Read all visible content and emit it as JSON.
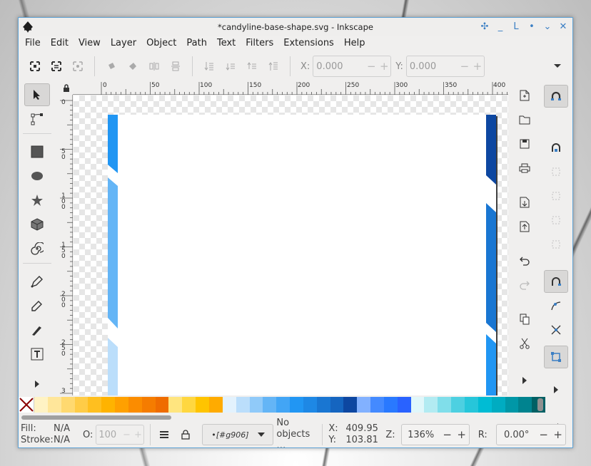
{
  "window": {
    "title": "*candyline-base-shape.svg - Inkscape"
  },
  "menu": [
    "File",
    "Edit",
    "View",
    "Layer",
    "Object",
    "Path",
    "Text",
    "Filters",
    "Extensions",
    "Help"
  ],
  "toolbar": {
    "x_label": "X:",
    "x_value": "0.000",
    "y_label": "Y:",
    "y_value": "0.000",
    "minus": "−",
    "plus": "+"
  },
  "rulers": {
    "top_labels": [
      "0",
      "50",
      "100",
      "150",
      "200",
      "250",
      "300",
      "350",
      "400"
    ],
    "left_labels": [
      "0",
      "5\n0",
      "1\n0\n0",
      "1\n5\n0",
      "2\n0\n0",
      "2\n5\n0",
      "3"
    ]
  },
  "palette": {
    "colors": [
      "#fff3c4",
      "#ffe69a",
      "#ffd970",
      "#ffcc47",
      "#ffbf1f",
      "#ffb300",
      "#ffa000",
      "#fb8c00",
      "#f57c00",
      "#ef6c00",
      "#ffe57f",
      "#ffd740",
      "#ffc400",
      "#ffab00",
      "#e3f2fd",
      "#bbdefb",
      "#90caf9",
      "#64b5f6",
      "#42a5f5",
      "#2196f3",
      "#1e88e5",
      "#1976d2",
      "#1565c0",
      "#0d47a1",
      "#82b1ff",
      "#448aff",
      "#2979ff",
      "#2962ff",
      "#e0f7fa",
      "#b2ebf2",
      "#80deea",
      "#4dd0e1",
      "#26c6da",
      "#00bcd4",
      "#00acc1",
      "#0097a7",
      "#00838f",
      "#006064"
    ]
  },
  "status": {
    "fill_label": "Fill:",
    "fill_value": "N/A",
    "stroke_label": "Stroke:",
    "stroke_value": "N/A",
    "opacity_label": "O:",
    "opacity_value": "100",
    "layer_name": "•[#g906]",
    "message_line1": "No",
    "message_line2": "objects …",
    "cursor_x_label": "X:",
    "cursor_x": "409.95",
    "cursor_y_label": "Y:",
    "cursor_y": "103.81",
    "zoom_label": "Z:",
    "zoom_value": "136%",
    "rotation_label": "R:",
    "rotation_value": "0.00°"
  },
  "colors": {
    "accent": "#3b7fc4",
    "left_stripes": [
      "#2196f3",
      "#64b5f6",
      "#bbdefb"
    ],
    "right_stripes": [
      "#0d47a1",
      "#1976d2",
      "#2196f3"
    ]
  },
  "icons": {
    "app": "inkscape-logo-icon"
  }
}
